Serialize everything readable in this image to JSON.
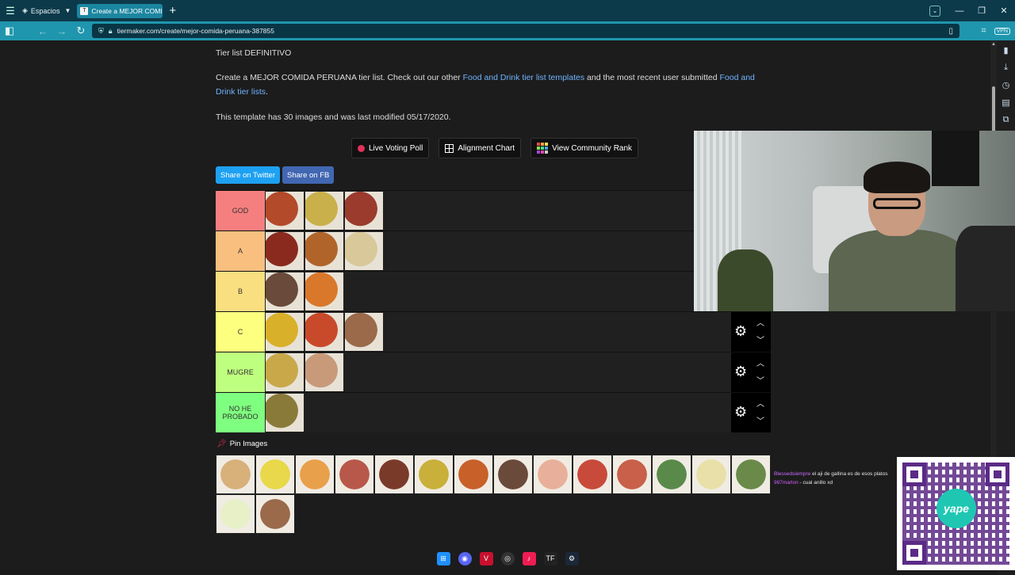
{
  "browser": {
    "spaces_label": "Espacios",
    "tab_title": "Create a MEJOR COMIDA P",
    "url": "tiermaker.com/create/mejor-comida-peruana-387855",
    "vpn_label": "VPN"
  },
  "page": {
    "subtitle": "Tier list DEFINITIVO",
    "intro_prefix": "Create a MEJOR COMIDA PERUANA tier list. Check out our other ",
    "intro_link1": "Food and Drink tier list templates",
    "intro_mid": " and the most recent user submitted ",
    "intro_link2": "Food and Drink tier lists",
    "intro_suffix": ".",
    "template_info": "This template has 30 images and was last modified 05/17/2020.",
    "buttons": {
      "live_voting": "Live Voting Poll",
      "alignment_chart": "Alignment Chart",
      "community_rank": "View Community Rank",
      "share_twitter": "Share on Twitter",
      "share_fb": "Share on FB"
    },
    "pin_images_label": "Pin Images"
  },
  "tiers": [
    {
      "label": "GOD",
      "color": "#f57f7f",
      "items": [
        "#b34a2a",
        "#c9b04a",
        "#9a3b2e"
      ]
    },
    {
      "label": "A",
      "color": "#f9bf7f",
      "items": [
        "#8a2a1e",
        "#b0642a",
        "#d8c89a"
      ]
    },
    {
      "label": "B",
      "color": "#f9df7f",
      "items": [
        "#6a4a3a",
        "#d9782a"
      ]
    },
    {
      "label": "C",
      "color": "#fdff7f",
      "items": [
        "#d9b02a",
        "#c84a2a",
        "#9a6a4a"
      ]
    },
    {
      "label": "MUGRE",
      "color": "#bfff7f",
      "items": [
        "#c9a84a",
        "#c89a7a"
      ]
    },
    {
      "label": "NO HE PROBADO",
      "color": "#7fff7f",
      "items": [
        "#8a7a3a"
      ]
    }
  ],
  "pool_items": [
    "#d8b07a",
    "#e8d84a",
    "#e8a04a",
    "#b8584a",
    "#7a3a2a",
    "#c8b03a",
    "#c8602a",
    "#6a4a3a",
    "#e8b09a",
    "#c84a3a",
    "#c8604a",
    "#5a8a4a",
    "#e8e0a8",
    "#6a8a4a",
    "#e8f0c8",
    "#9a6a4a"
  ],
  "chat": [
    {
      "user": "Blessedsiempre",
      "msg": "el aji de gallina es de esos platos"
    },
    {
      "user": "987marlon",
      "msg": "- cual anillo xd"
    }
  ],
  "qr_logo": "yape",
  "icons": {
    "menu": "menu-icon",
    "gear": "gear-icon",
    "pin": "pin-icon"
  }
}
